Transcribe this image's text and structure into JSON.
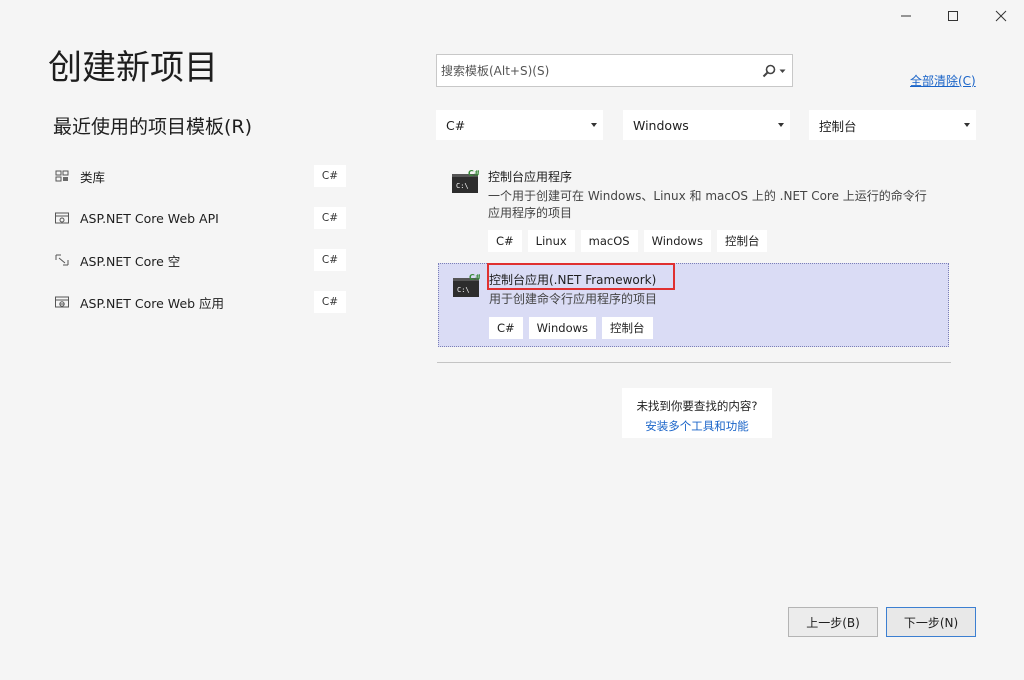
{
  "page_title": "创建新项目",
  "recent": {
    "title": "最近使用的项目模板(R)",
    "items": [
      {
        "label": "类库",
        "lang": "C#",
        "icon": "class-library-icon"
      },
      {
        "label": "ASP.NET Core Web API",
        "lang": "C#",
        "icon": "web-api-icon"
      },
      {
        "label": "ASP.NET Core 空",
        "lang": "C#",
        "icon": "empty-web-icon"
      },
      {
        "label": "ASP.NET Core Web 应用",
        "lang": "C#",
        "icon": "web-app-icon"
      }
    ]
  },
  "search": {
    "placeholder": "搜索模板(Alt+S)(S)"
  },
  "clear_all": "全部清除(C)",
  "filters": {
    "language": "C#",
    "platform": "Windows",
    "project_type": "控制台"
  },
  "templates": [
    {
      "name": "控制台应用程序",
      "description": "一个用于创建可在 Windows、Linux 和 macOS 上的 .NET Core 上运行的命令行应用程序的项目",
      "tags": [
        "C#",
        "Linux",
        "macOS",
        "Windows",
        "控制台"
      ],
      "icon_badge": "C#",
      "icon_text": "C:\\"
    },
    {
      "name": "控制台应用(.NET Framework)",
      "description": "用于创建命令行应用程序的项目",
      "tags": [
        "C#",
        "Windows",
        "控制台"
      ],
      "icon_badge": "C#",
      "icon_text": "C:\\"
    }
  ],
  "not_found": {
    "question": "未找到你要查找的内容?",
    "link": "安装多个工具和功能"
  },
  "buttons": {
    "back": "上一步(B)",
    "next": "下一步(N)"
  },
  "colors": {
    "selected_bg": "#dadcf5",
    "highlight_border": "#e03030",
    "link": "#1a64c8"
  }
}
